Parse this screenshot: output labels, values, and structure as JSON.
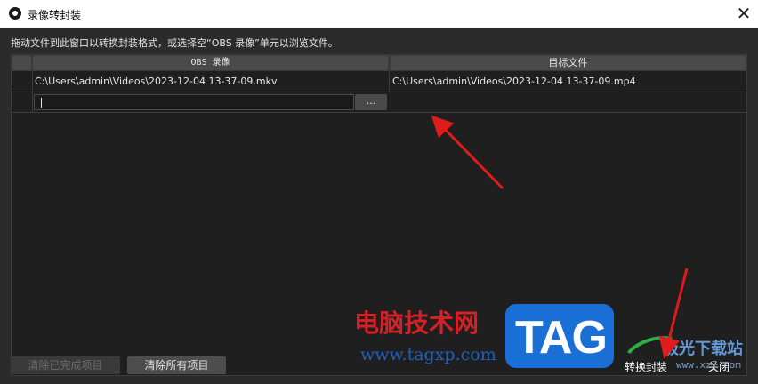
{
  "window": {
    "title": "录像转封装",
    "close_glyph": "✕"
  },
  "dialog": {
    "hint": "拖动文件到此窗口以转换封装格式，或选择空“OBS 录像”单元以浏览文件。"
  },
  "table": {
    "columns": [
      "OBS 录像",
      "目标文件"
    ],
    "rows": [
      {
        "obs_recording": "C:\\Users\\admin\\Videos\\2023-12-04 13-37-09.mkv",
        "target_file": "C:\\Users\\admin\\Videos\\2023-12-04 13-37-09.mp4"
      }
    ],
    "edit_row": {
      "input_value": "",
      "browse_label": "..."
    }
  },
  "buttons": {
    "clear_finished": "清除已完成项目",
    "clear_all": "清除所有项目",
    "remux": "转换封装",
    "close": "关闭"
  },
  "watermark": {
    "site_name": "电脑技术网",
    "site_url": "www.tagxp.com",
    "tag_logo": "TAG",
    "site2_name": "极光下载站",
    "site2_url": "www.xz7.com"
  },
  "annotations": {
    "arrow_color": "#e01b1b"
  },
  "colors": {
    "background": "#2b2b2b",
    "table_bg": "#1f1f1f",
    "text": "#e6e6e6",
    "disabled_text": "#6d6d6d"
  }
}
